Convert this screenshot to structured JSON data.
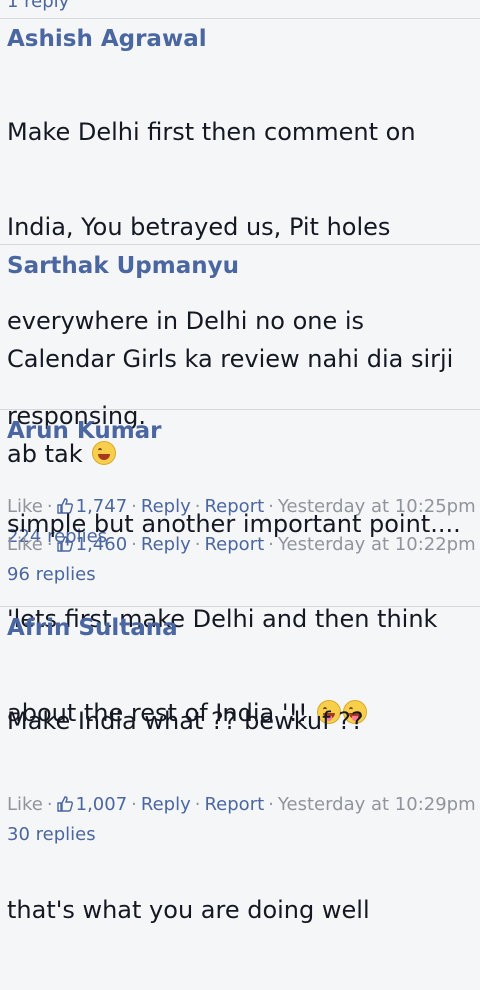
{
  "top_fragment": "1 reply",
  "comments": [
    {
      "author": "Ashish Agrawal",
      "lines": [
        "Make Delhi first then comment on",
        "India, You betrayed us, Pit holes",
        "everywhere in Delhi no one is",
        "responsing."
      ],
      "like_label": "Like",
      "likes": "1,747",
      "reply_label": "Reply",
      "report_label": "Report",
      "time": "Yesterday at 10:25pm",
      "replies": "224 replies"
    },
    {
      "author": "Sarthak Upmanyu",
      "lines": [
        "Calendar Girls ka review nahi dia sirji",
        "ab tak"
      ],
      "like_label": "Like",
      "likes": "1,460",
      "reply_label": "Reply",
      "report_label": "Report",
      "time": "Yesterday at 10:22pm",
      "replies": "96 replies"
    },
    {
      "author": "Arun Kumar",
      "lines": [
        "simple but another important point....",
        "'lets first make Delhi and then think",
        "about the rest of India '!!"
      ],
      "like_label": "Like",
      "likes": "1,007",
      "reply_label": "Reply",
      "report_label": "Report",
      "time": "Yesterday at 10:29pm",
      "replies": "30 replies"
    },
    {
      "author": "Afrin Sultana",
      "lines": [
        "Make India what ?? bewkuf ??",
        "",
        "that's what you are doing well"
      ]
    }
  ],
  "icons": {
    "like": "thumbs-up-icon",
    "emoji_laugh": "laughing-emoji-icon",
    "emoji_tongue": "tongue-out-emoji-icon"
  },
  "colors": {
    "link": "#4b67a1",
    "muted": "#90949c",
    "text": "#141823",
    "background": "#f5f6f7"
  }
}
